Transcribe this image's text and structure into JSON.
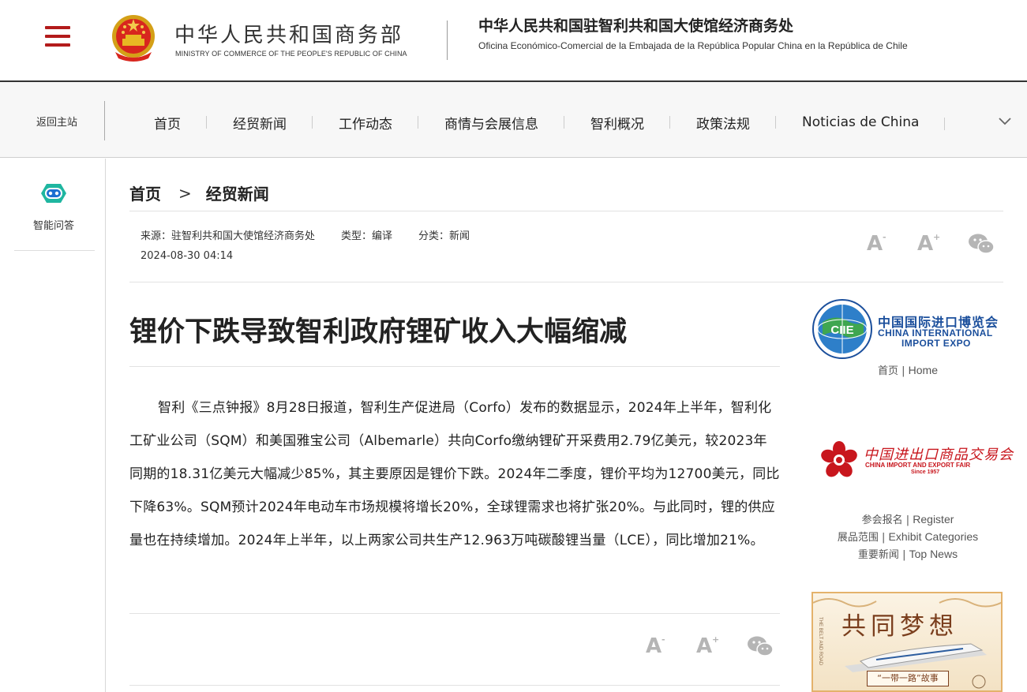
{
  "header": {
    "ministry_cn": "中华人民共和国商务部",
    "ministry_en": "MINISTRY OF COMMERCE OF THE PEOPLE'S REPUBLIC OF CHINA",
    "office_cn": "中华人民共和国驻智利共和国大使馆经济商务处",
    "office_es": "Oficina Económico-Comercial de la Embajada de la República Popular China en la República de Chile"
  },
  "nav": {
    "back_label": "返回主站",
    "items": [
      "首页",
      "经贸新闻",
      "工作动态",
      "商情与会展信息",
      "智利概况",
      "政策法规",
      "Noticias de China"
    ]
  },
  "sidebar": {
    "ai_label": "智能问答"
  },
  "breadcrumb": {
    "home": "首页",
    "arrow": ">",
    "current": "经贸新闻"
  },
  "meta": {
    "source": "来源：驻智利共和国大使馆经济商务处",
    "type": "类型：编译",
    "category": "分类：新闻",
    "date": "2024-08-30 04:14"
  },
  "tools": {
    "font_small": "A",
    "font_small_sup": "-",
    "font_large": "A",
    "font_large_sup": "+"
  },
  "article": {
    "title": "锂价下跌导致智利政府锂矿收入大幅缩减",
    "body": "智利《三点钟报》8月28日报道，智利生产促进局（Corfo）发布的数据显示，2024年上半年，智利化工矿业公司（SQM）和美国雅宝公司（Albemarle）共向Corfo缴纳锂矿开采费用2.79亿美元，较2023年同期的18.31亿美元大幅减少85%，其主要原因是锂价下跌。2024年二季度，锂价平均为12700美元，同比下降63%。SQM预计2024年电动车市场规模将增长20%，全球锂需求也将扩张20%。与此同时，锂的供应量也在持续增加。2024年上半年，以上两家公司共生产12.963万吨碳酸锂当量（LCE），同比增加21%。"
  },
  "right": {
    "ciie": {
      "logo_text": "CIIE",
      "cn": "中国国际进口博览会",
      "en_line1": "CHINA INTERNATIONAL",
      "en_line2": "IMPORT EXPO",
      "home_cn": "首页",
      "home_sep": "|",
      "home_en": "Home"
    },
    "canton": {
      "cn": "中国进出口商品交易会",
      "en": "CHINA IMPORT AND EXPORT FAIR",
      "since": "Since 1957",
      "links": [
        {
          "cn": "参会报名",
          "en": "Register"
        },
        {
          "cn": "展品范围",
          "en": "Exhibit Categories"
        },
        {
          "cn": "重要新闻",
          "en": "Top News"
        }
      ],
      "sep": "|"
    },
    "banner": {
      "title": "共同梦想",
      "subtitle": "“一带一路”故事",
      "vertical": "THE BELT AND ROAD"
    }
  },
  "colors": {
    "accent_red": "#b31b1b",
    "ciie_blue": "#1b4f9c",
    "canton_red": "#c8161d"
  }
}
